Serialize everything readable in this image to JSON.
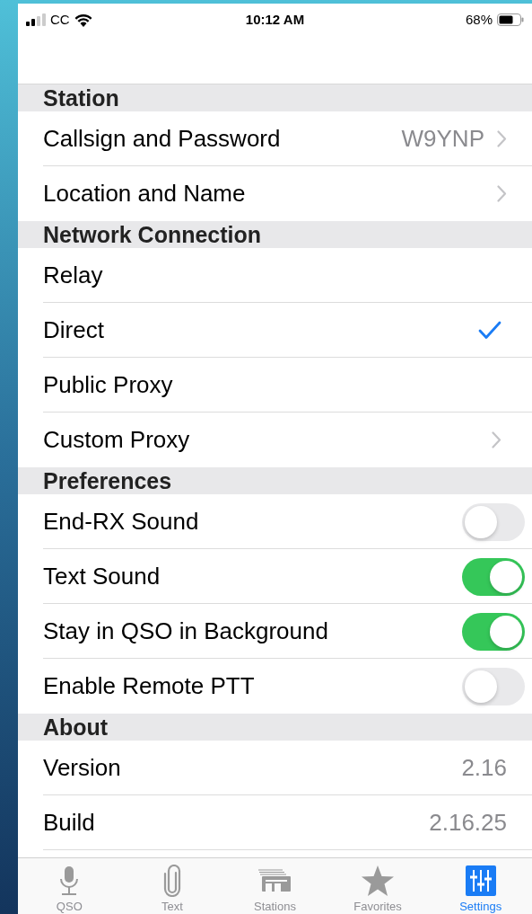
{
  "status_bar": {
    "carrier": "CC",
    "time": "10:12 AM",
    "battery": "68%"
  },
  "sections": [
    {
      "title": "Station",
      "rows": [
        {
          "kind": "link",
          "label": "Callsign and Password",
          "value": "W9YNP"
        },
        {
          "kind": "link",
          "label": "Location and Name"
        }
      ]
    },
    {
      "title": "Network Connection",
      "rows": [
        {
          "kind": "option",
          "label": "Relay",
          "selected": false
        },
        {
          "kind": "option",
          "label": "Direct",
          "selected": true
        },
        {
          "kind": "option",
          "label": "Public Proxy",
          "selected": false
        },
        {
          "kind": "option",
          "label": "Custom Proxy",
          "selected": false,
          "chevron": true
        }
      ]
    },
    {
      "title": "Preferences",
      "rows": [
        {
          "kind": "toggle",
          "label": "End-RX Sound",
          "on": false
        },
        {
          "kind": "toggle",
          "label": "Text Sound",
          "on": true
        },
        {
          "kind": "toggle",
          "label": "Stay in QSO in Background",
          "on": true
        },
        {
          "kind": "toggle",
          "label": "Enable Remote PTT",
          "on": false
        }
      ]
    },
    {
      "title": "About",
      "rows": [
        {
          "kind": "info",
          "label": "Version",
          "value": "2.16"
        },
        {
          "kind": "info",
          "label": "Build",
          "value": "2.16.25"
        }
      ]
    }
  ],
  "tabs": [
    {
      "label": "QSO",
      "selected": false
    },
    {
      "label": "Text",
      "selected": false
    },
    {
      "label": "Stations",
      "selected": false
    },
    {
      "label": "Favorites",
      "selected": false
    },
    {
      "label": "Settings",
      "selected": true
    }
  ]
}
